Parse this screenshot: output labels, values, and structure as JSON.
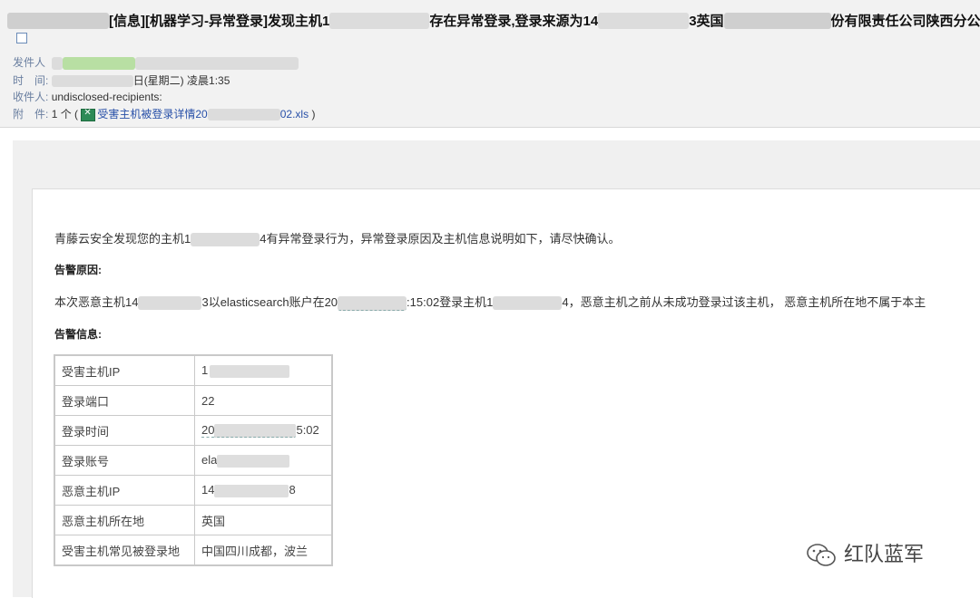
{
  "header": {
    "subject_prefix": "[信息][机器学习-异常登录]发现主机1",
    "subject_mid": "存在异常登录,登录来源为14",
    "subject_mid2": "3英国",
    "subject_suffix": "份有限责任公司陕西分公司",
    "from_label": "发件人",
    "time_label": "时　间:",
    "time_value": "日(星期二) 凌晨1:35",
    "to_label": "收件人:",
    "to_value": "undisclosed-recipients:",
    "attach_label": "附　件:",
    "attach_count": "1 个 (",
    "attach_name_start": "受害主机被登录详情20",
    "attach_name_end": "02.xls",
    "attach_close": ")"
  },
  "body": {
    "intro_start": "青藤云安全发现您的主机1",
    "intro_end": "4有异常登录行为，异常登录原因及主机信息说明如下，请尽快确认。",
    "reason_title": "告警原因:",
    "reason_a": "本次恶意主机14",
    "reason_b": "3以elasticsearch账户在20",
    "reason_c": ":15:02登录主机1",
    "reason_d": "4，恶意主机之前从未成功登录过该主机， 恶意主机所在地不属于本主",
    "info_title": "告警信息:"
  },
  "table": {
    "rows": [
      {
        "key": "受害主机IP",
        "value": "1"
      },
      {
        "key": "登录端口",
        "value": "22"
      },
      {
        "key": "登录时间",
        "value_start": "20",
        "value_end": "5:02"
      },
      {
        "key": "登录账号",
        "value": "ela"
      },
      {
        "key": "恶意主机IP",
        "value_start": "14",
        "value_end": "8"
      },
      {
        "key": "恶意主机所在地",
        "value": "英国"
      },
      {
        "key": "受害主机常见被登录地",
        "value": "中国四川成都，波兰"
      }
    ]
  },
  "watermark": {
    "text": "红队蓝军",
    "icon": "wechat-icon"
  }
}
